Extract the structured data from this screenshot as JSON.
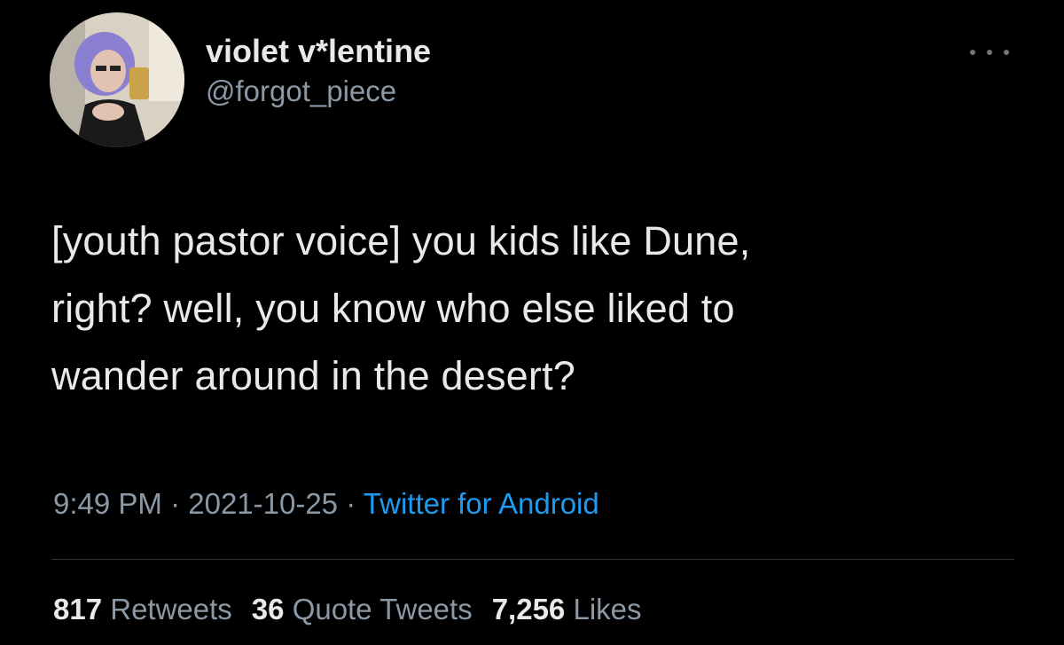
{
  "user": {
    "display_name": "violet v*lentine",
    "handle": "@forgot_piece"
  },
  "tweet": {
    "lines": [
      "[youth pastor voice] you kids like Dune,",
      "right? well, you know who else liked to",
      "wander around in the desert?"
    ]
  },
  "meta": {
    "time": "9:49 PM",
    "separator": " · ",
    "date": "2021-10-25",
    "source": "Twitter for Android"
  },
  "stats": {
    "retweets_count": "817",
    "retweets_label": "Retweets",
    "quotes_count": "36",
    "quotes_label": "Quote Tweets",
    "likes_count": "7,256",
    "likes_label": "Likes"
  },
  "icons": {
    "more": "more-horizontal-icon"
  },
  "colors": {
    "background": "#000000",
    "text": "#e7e9ea",
    "secondary": "#8b98a5",
    "link": "#1d9bf0",
    "divider": "#2f3336"
  }
}
